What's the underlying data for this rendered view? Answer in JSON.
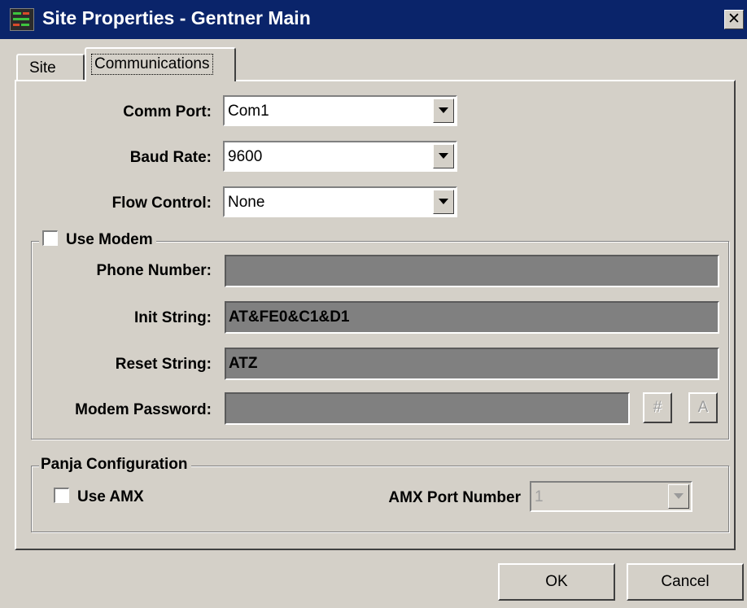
{
  "window": {
    "title": "Site Properties - Gentner Main",
    "icon": "app-rack-icon",
    "close_glyph": "✕"
  },
  "tabs": [
    {
      "label": "Site",
      "active": false
    },
    {
      "label": "Communications",
      "active": true
    }
  ],
  "communications": {
    "comm_port": {
      "label": "Comm Port:",
      "value": "Com1"
    },
    "baud_rate": {
      "label": "Baud Rate:",
      "value": "9600"
    },
    "flow_control": {
      "label": "Flow Control:",
      "value": "None"
    }
  },
  "modem": {
    "group_label": "Use Modem",
    "use_modem_checked": false,
    "phone_number": {
      "label": "Phone Number:",
      "value": ""
    },
    "init_string": {
      "label": "Init String:",
      "value": "AT&FE0&C1&D1"
    },
    "reset_string": {
      "label": "Reset String:",
      "value": "ATZ"
    },
    "modem_password": {
      "label": "Modem Password:",
      "value": ""
    },
    "hash_button": "#",
    "a_button": "A"
  },
  "panja": {
    "group_label": "Panja Configuration",
    "use_amx": {
      "label": "Use AMX",
      "checked": false
    },
    "amx_port": {
      "label": "AMX Port Number",
      "value": "1"
    }
  },
  "buttons": {
    "ok": "OK",
    "cancel": "Cancel"
  }
}
